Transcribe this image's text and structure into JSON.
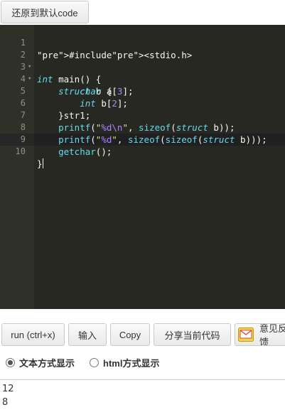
{
  "topbar": {
    "reset_label": "还原到默认code"
  },
  "editor": {
    "line_numbers": [
      "1",
      "2",
      "3",
      "4",
      "5",
      "6",
      "7",
      "8",
      "9",
      "10"
    ],
    "fold_lines": [
      2,
      3
    ],
    "active_line": 10,
    "code_lines": [
      "#include<stdio.h>",
      "int main() {",
      "    struct b {",
      "        char a[3];",
      "        int b[2];",
      "    }str1;",
      "    printf(\"%d\\n\", sizeof(struct b));",
      "    printf(\"%d\", sizeof(sizeof(struct b)));",
      "    getchar();",
      "}"
    ]
  },
  "toolbar": {
    "run_label": "run (ctrl+x)",
    "input_label": "输入",
    "copy_label": "Copy",
    "share_label": "分享当前代码",
    "feedback_label": "意见反馈"
  },
  "display_mode": {
    "text_label": "文本方式显示",
    "html_label": "html方式显示",
    "selected": "text"
  },
  "output": {
    "lines": [
      "12",
      "8"
    ]
  },
  "colors": {
    "editor_background": "#272822",
    "gutter_background": "#2f3129",
    "keyword": "#66d9ef",
    "preprocessor": "#f92672",
    "string": "#e6db74",
    "number": "#ae81ff"
  }
}
